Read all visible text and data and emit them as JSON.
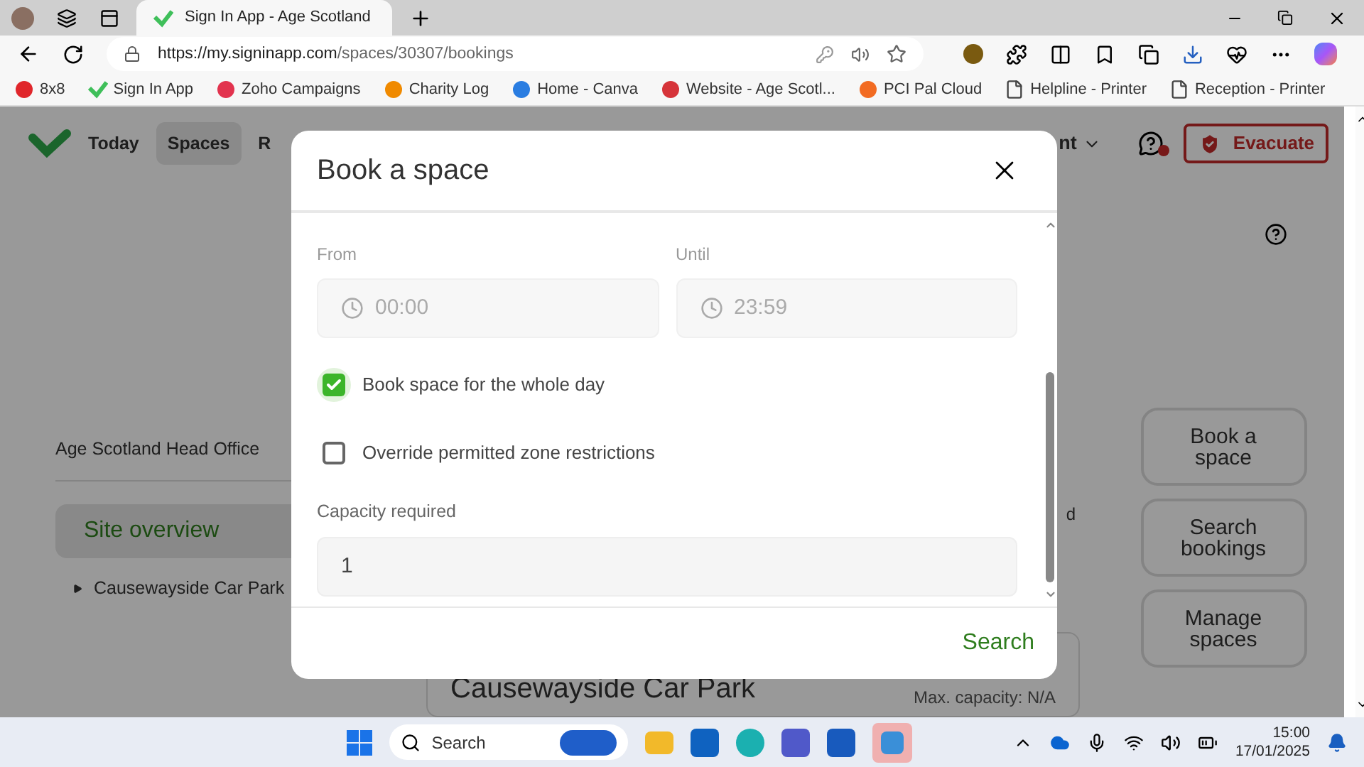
{
  "browser": {
    "tabs": [
      {
        "title": "Sign In App - Age Scotland",
        "selected": true
      }
    ],
    "url": {
      "host": "https://my.signinapp.com",
      "path": "/spaces/30307/bookings"
    },
    "bookmarks": [
      {
        "label": "8x8"
      },
      {
        "label": "Sign In App"
      },
      {
        "label": "Zoho Campaigns"
      },
      {
        "label": "Charity Log"
      },
      {
        "label": "Home - Canva"
      },
      {
        "label": "Website - Age Scotl..."
      },
      {
        "label": "PCI Pal Cloud"
      },
      {
        "label": "Helpline - Printer"
      },
      {
        "label": "Reception - Printer"
      }
    ]
  },
  "app": {
    "nav": [
      {
        "label": "Today",
        "selected": false
      },
      {
        "label": "Spaces",
        "selected": true
      },
      {
        "label": "R",
        "selected": false
      }
    ],
    "nav_right": "nt",
    "evacuate": "Evacuate",
    "site": "Age Scotland Head Office",
    "sidebar": [
      {
        "label": "Site overview",
        "selected": true
      }
    ],
    "tree": [
      {
        "label": "Causewayside Car Park",
        "expanded": false
      }
    ],
    "column_2": "d",
    "card": {
      "title": "Causewayside Car Park",
      "capacity": "Max. capacity: N/A"
    },
    "actions": [
      "Book a space",
      "Search bookings",
      "Manage spaces"
    ]
  },
  "modal": {
    "title": "Book a space",
    "from": {
      "label": "From",
      "value": "00:00"
    },
    "until": {
      "label": "Until",
      "value": "23:59"
    },
    "checkboxes": [
      {
        "label": "Book space for the whole day",
        "checked": true
      },
      {
        "label": "Override permitted zone restrictions",
        "checked": false
      }
    ],
    "capacity": {
      "label": "Capacity required",
      "value": "1"
    },
    "submit": "Search"
  },
  "taskbar": {
    "search": "Search",
    "time": "15:00",
    "date": "17/01/2025"
  }
}
